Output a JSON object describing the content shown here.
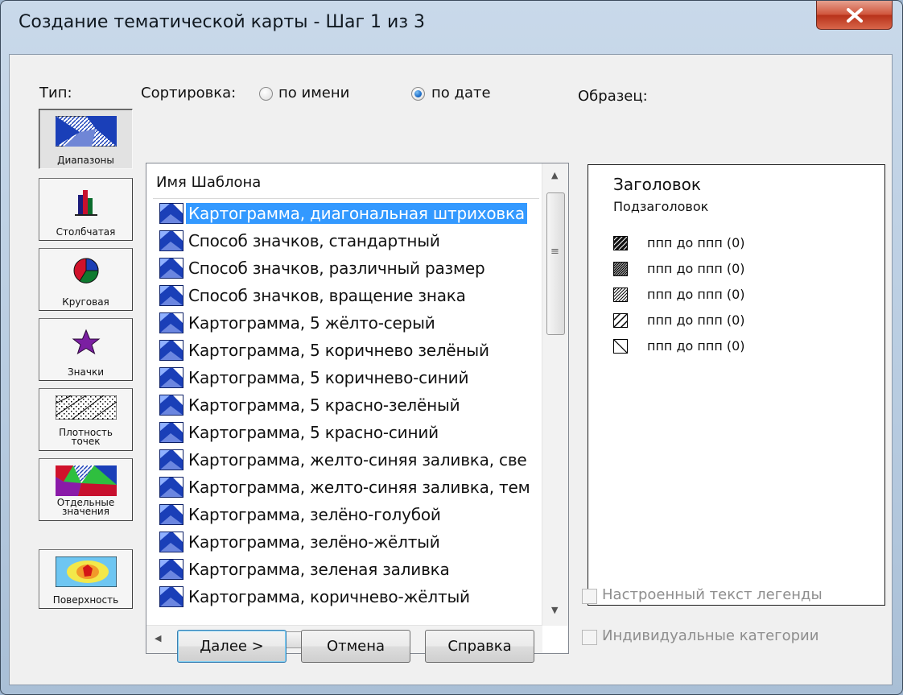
{
  "window": {
    "title": "Создание тематической карты - Шаг 1 из 3"
  },
  "type_panel": {
    "label": "Тип:",
    "buttons": [
      {
        "id": "ranges",
        "label": "Диапазоны",
        "pressed": true
      },
      {
        "id": "bar",
        "label": "Столбчатая"
      },
      {
        "id": "pie",
        "label": "Круговая"
      },
      {
        "id": "symbols",
        "label": "Значки"
      },
      {
        "id": "dot-density",
        "label_lines": [
          "Плотность",
          "точек"
        ]
      },
      {
        "id": "individual",
        "label_lines": [
          "Отдельные",
          "значения"
        ]
      },
      {
        "id": "grid",
        "label": "Поверхность"
      }
    ]
  },
  "sort": {
    "label": "Сортировка:",
    "options": [
      {
        "label": "по имени",
        "selected": false
      },
      {
        "label": "по дате",
        "selected": true
      }
    ]
  },
  "template_list": {
    "header": "Имя Шаблона",
    "items": [
      {
        "label": "Картограмма, диагональная штриховка",
        "selected": true
      },
      {
        "label": "Способ значков, стандартный"
      },
      {
        "label": "Способ значков, различный размер"
      },
      {
        "label": "Способ значков, вращение знака"
      },
      {
        "label": "Картограмма, 5 жёлто-серый"
      },
      {
        "label": "Картограмма, 5 коричнево зелёный"
      },
      {
        "label": "Картограмма, 5 коричнево-синий"
      },
      {
        "label": "Картограмма, 5 красно-зелёный"
      },
      {
        "label": "Картограмма, 5 красно-синий"
      },
      {
        "label": "Картограмма, желто-синяя заливка, све"
      },
      {
        "label": "Картограмма, желто-синяя заливка, тем"
      },
      {
        "label": "Картограмма, зелёно-голубой"
      },
      {
        "label": "Картограмма, зелёно-жёлтый"
      },
      {
        "label": "Картограмма, зеленая заливка"
      },
      {
        "label": "Картограмма, коричнево-жёлтый"
      }
    ]
  },
  "preview": {
    "label": "Образец:",
    "title": "Заголовок",
    "subtitle": "Подзаголовок",
    "legend": [
      {
        "text": "ппп до ппп  (0)",
        "pattern": "dense"
      },
      {
        "text": "ппп до ппп  (0)",
        "pattern": "medium"
      },
      {
        "text": "ппп до ппп  (0)",
        "pattern": "light"
      },
      {
        "text": "ппп до ппп  (0)",
        "pattern": "sparse"
      },
      {
        "text": "ппп до ппп  (0)",
        "pattern": "single"
      }
    ]
  },
  "options": {
    "custom_legend_text": {
      "label": "Настроенный текст легенды",
      "checked": false,
      "enabled": false
    },
    "individual_categories": {
      "label": "Индивидуальные категории",
      "checked": false,
      "enabled": false
    }
  },
  "buttons": {
    "next": "Далее >",
    "cancel": "Отмена",
    "help": "Справка"
  },
  "colors": {
    "selection": "#3399ff",
    "close_button": "#c8442b",
    "titlebar": "#c0d3e7"
  }
}
